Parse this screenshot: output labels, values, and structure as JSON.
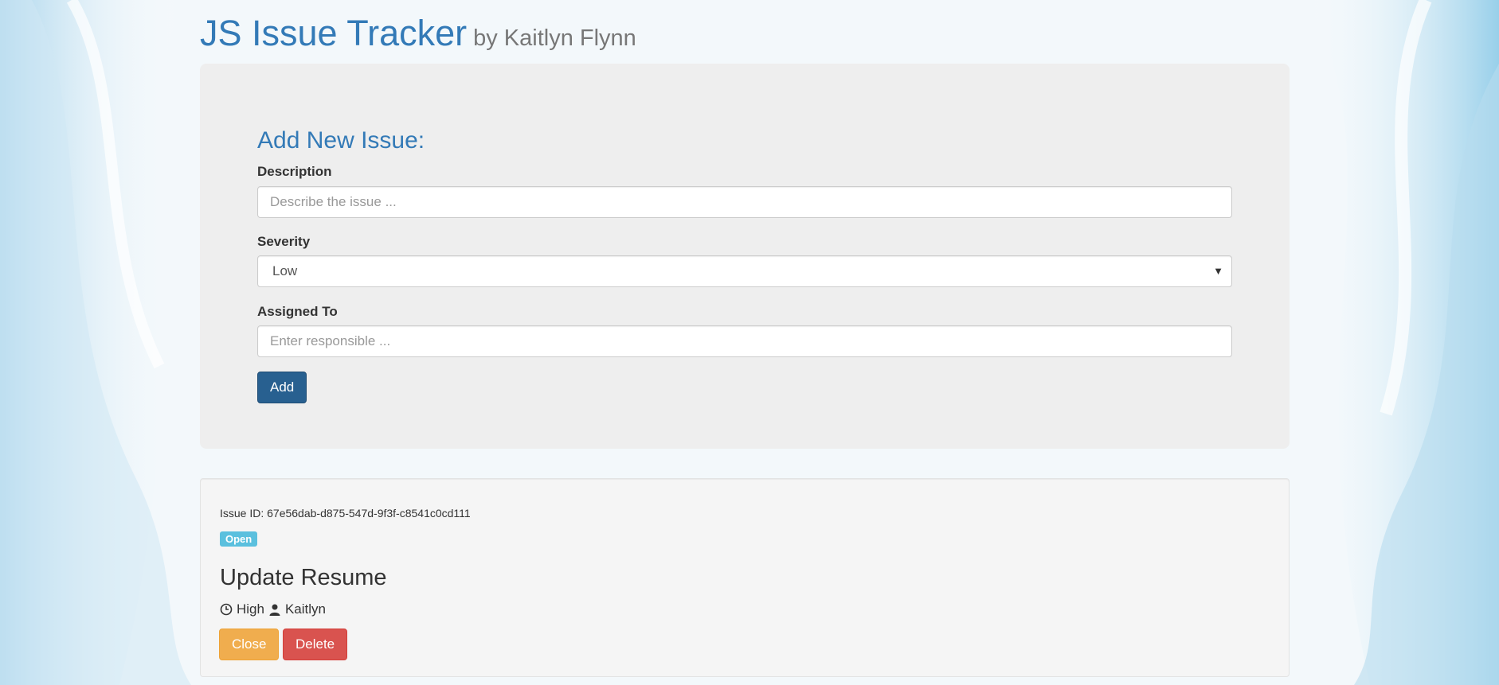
{
  "header": {
    "title": "JS Issue Tracker",
    "subtitle": "by Kaitlyn Flynn"
  },
  "form": {
    "heading": "Add New Issue:",
    "description_label": "Description",
    "description_placeholder": "Describe the issue ...",
    "description_value": "",
    "severity_label": "Severity",
    "severity_value": "Low",
    "assigned_label": "Assigned To",
    "assigned_placeholder": "Enter responsible ...",
    "assigned_value": "",
    "add_label": "Add"
  },
  "issues": [
    {
      "id_label": "Issue ID: 67e56dab-d875-547d-9f3f-c8541c0cd111",
      "status": "Open",
      "title": "Update Resume",
      "severity": "High",
      "assigned": "Kaitlyn",
      "severity_icon": "clock-icon",
      "assigned_icon": "user-icon",
      "close_label": "Close",
      "delete_label": "Delete"
    }
  ],
  "colors": {
    "primary": "#337ab7",
    "add_button": "#286090",
    "info_badge": "#5bc0de",
    "warning_button": "#f0ad4e",
    "danger_button": "#d9534f"
  }
}
